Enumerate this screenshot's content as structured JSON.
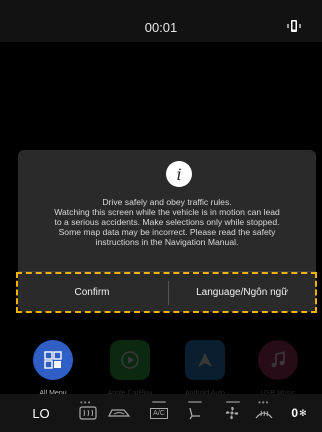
{
  "status_bar": {
    "time": "00:01",
    "icons": [
      "phone-vibrate-icon"
    ]
  },
  "dialog": {
    "icon": "info-icon",
    "icon_glyph": "i",
    "message_lines": [
      "Drive safely and obey traffic rules.",
      "Watching this screen while the vehicle is in motion can lead",
      "to a serious accidents. Make selections only while stopped.",
      "Some map data may be incorrect. Please read the safety",
      "instructions in the Navigation Manual."
    ],
    "confirm_label": "Confirm",
    "language_label": "Language/Ngôn ngữ"
  },
  "home_apps": [
    {
      "label": "All Menu",
      "icon": "grid-icon",
      "color": "#2f5ec4"
    },
    {
      "label": "Apple CarPlay",
      "icon": "play-icon",
      "color": "#3db54a"
    },
    {
      "label": "Android Auto",
      "icon": "android-auto-icon",
      "color": "#2f8ad8"
    },
    {
      "label": "USB Music",
      "icon": "music-note-icon",
      "color": "#b03a6a"
    }
  ],
  "climate": {
    "left_temp": "LO",
    "right_temp": "0",
    "icons": [
      "rear-defrost-icon",
      "recirculation-icon",
      "ac-icon",
      "seat-heat-icon",
      "fan-icon",
      "front-defrost-icon"
    ],
    "ac_label": "A/C"
  },
  "colors": {
    "highlight": "#f0b400",
    "dialog_bg": "#2a2a2a"
  }
}
